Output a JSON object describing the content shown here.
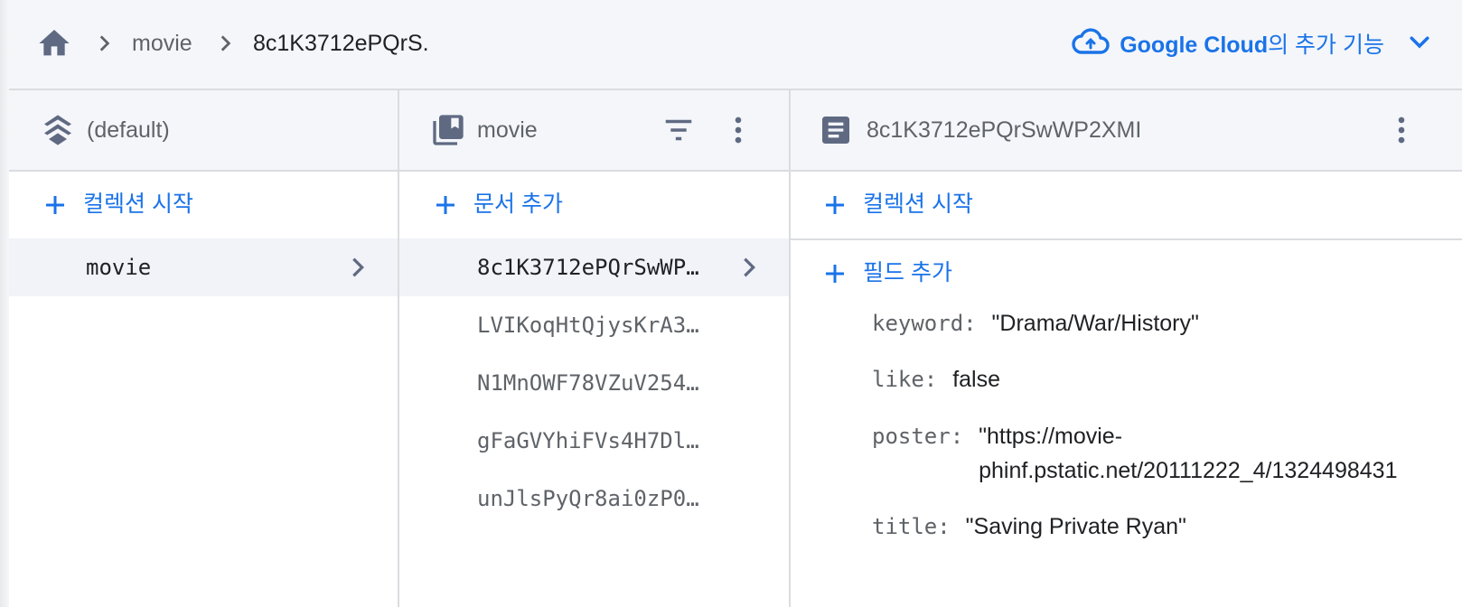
{
  "breadcrumb": {
    "items": [
      "movie",
      "8c1K3712ePQrS."
    ]
  },
  "header_link": {
    "brand": "Google Cloud",
    "suffix": "의 추가 기능"
  },
  "panels": {
    "root": {
      "title": "(default)",
      "add_label": "컬렉션 시작",
      "items": [
        "movie"
      ]
    },
    "collection": {
      "title": "movie",
      "add_label": "문서 추가",
      "items": [
        "8c1K3712ePQrSwWP…",
        "LVIKoqHtQjysKrA3…",
        "N1MnOWF78VZuV254…",
        "gFaGVYhiFVs4H7Dl…",
        "unJlsPyQr8ai0zP0…"
      ]
    },
    "document": {
      "title": "8c1K3712ePQrSwWP2XMI",
      "add_collection_label": "컬렉션 시작",
      "add_field_label": "필드 추가",
      "fields": [
        {
          "key": "keyword:",
          "value": "\"Drama/War/History\""
        },
        {
          "key": "like:",
          "value": "false"
        },
        {
          "key": "poster:",
          "value_line1": "\"https://movie-",
          "value_line2": "phinf.pstatic.net/20111222_4/1324498431"
        },
        {
          "key": "title:",
          "value": "\"Saving Private Ryan\""
        }
      ]
    }
  },
  "colors": {
    "accent": "#1a73e8",
    "header_bg": "#f4f6fa",
    "selected_bg": "#f1f3f8",
    "icon": "#5f6368"
  }
}
